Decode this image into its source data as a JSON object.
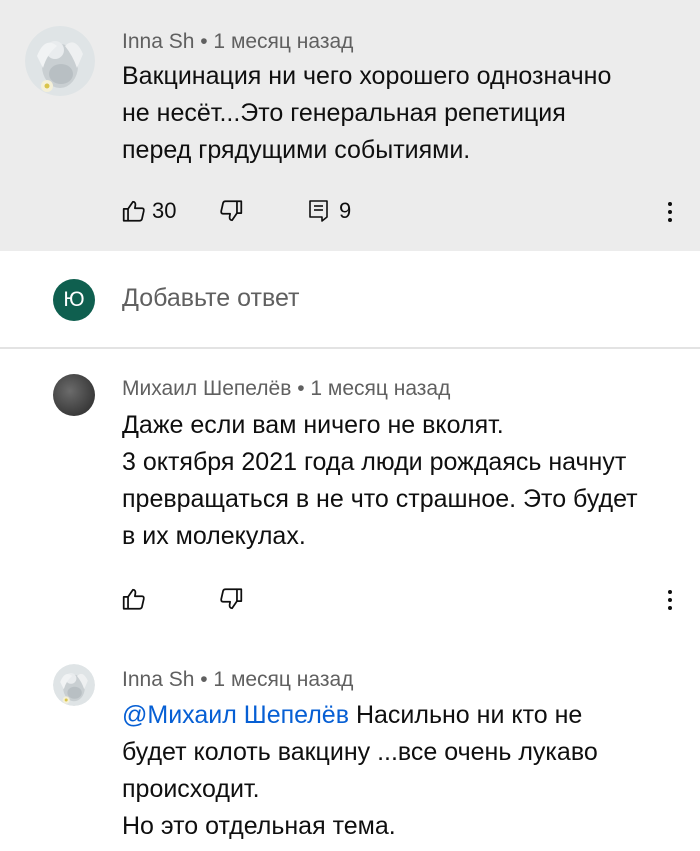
{
  "comments": [
    {
      "author": "Inna Sh",
      "time": " • 1 месяц назад",
      "lines": [
        "Вакцинация ни чего хорошего однозначно",
        "не несёт...Это генеральная репетиция",
        "перед грядущими событиями."
      ],
      "likes": "30",
      "replies": "9"
    },
    {
      "author": "Михаил Шепелёв",
      "time": " • 1 месяц назад",
      "lines": [
        "Даже если вам ничего не вколят.",
        "3 октября 2021 года люди рождаясь начнут",
        "превращаться в не что страшное. Это будет",
        "в их молекулах."
      ]
    },
    {
      "author": "Inna Sh",
      "time": " • 1 месяц назад",
      "mention": "@Михаил Шепелёв",
      "first_line_rest": " Насильно ни кто не",
      "lines": [
        "будет колоть вакцину ...все очень лукаво",
        "происходит.",
        "Но это отдельная тема."
      ]
    }
  ],
  "reply_box": {
    "avatar_letter": "Ю",
    "placeholder": "Добавьте ответ"
  },
  "colors": {
    "highlight_bg": "#ececec",
    "secondary_text": "#606060",
    "mention": "#065fd4",
    "user_avatar": "#0f5f4f"
  }
}
